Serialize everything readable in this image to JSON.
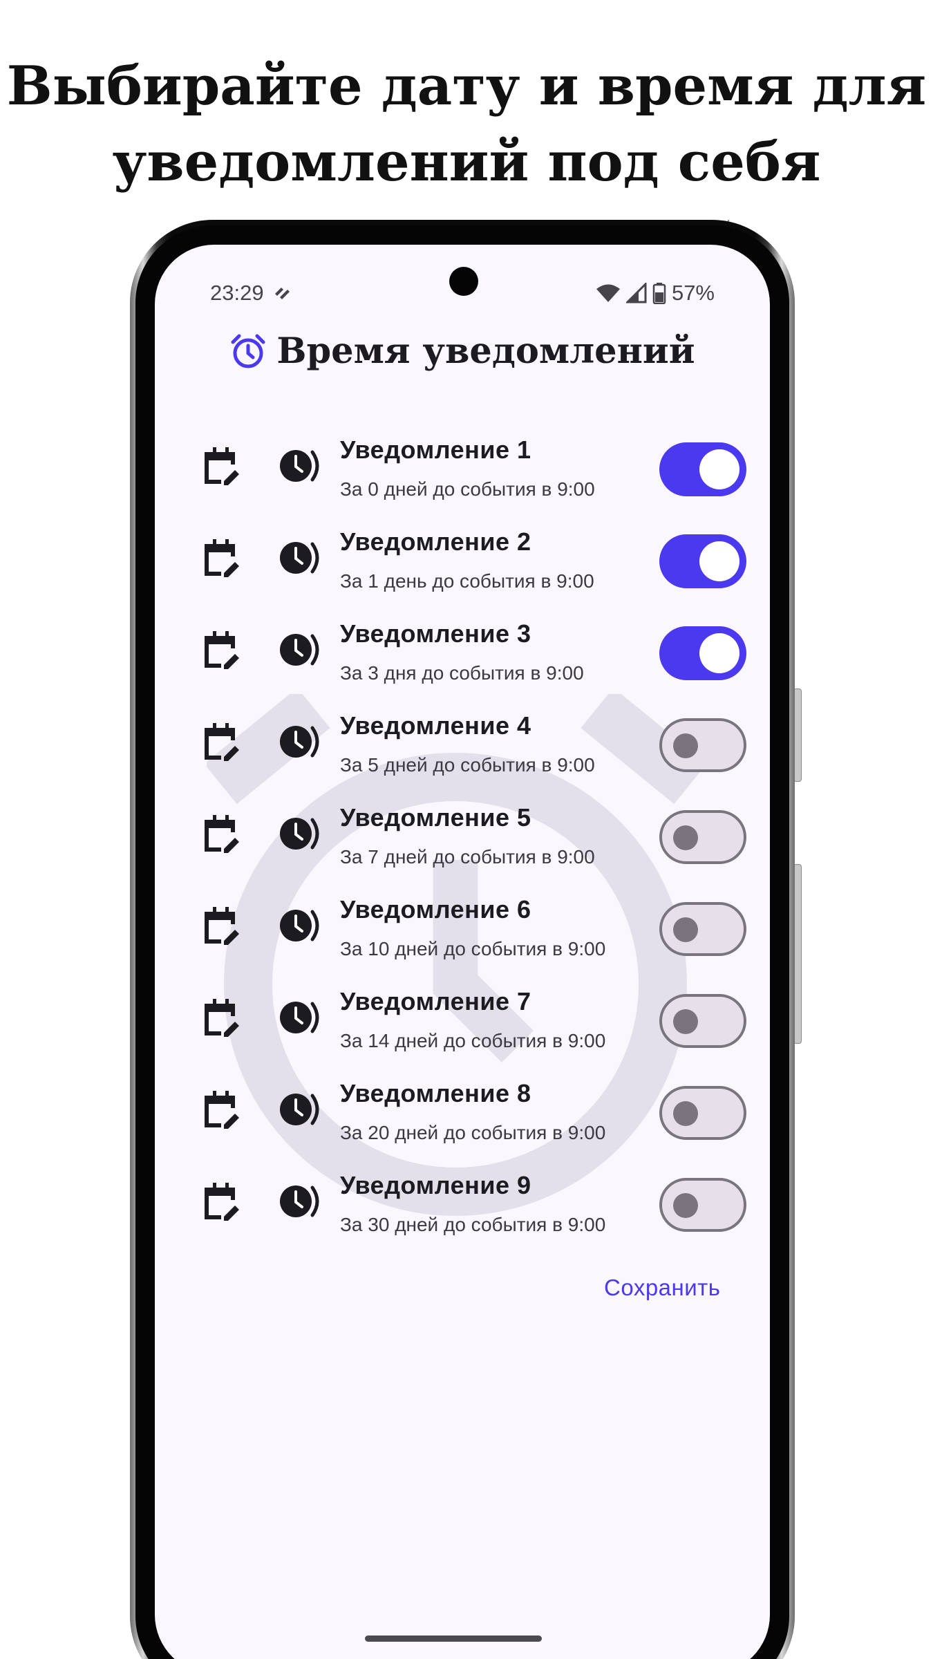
{
  "promo": {
    "line1": "Выбирайте дату и время для",
    "line2": "уведомлений под себя"
  },
  "status_bar": {
    "time": "23:29",
    "battery": "57%"
  },
  "dialog": {
    "title": "Время уведомлений",
    "title_icon": "alarm-clock-icon",
    "accent_color": "#4b39ef"
  },
  "notifications": [
    {
      "name": "Уведомление 1",
      "desc": "За 0 дней до события в 9:00",
      "enabled": true
    },
    {
      "name": "Уведомление 2",
      "desc": "За 1 день до события в 9:00",
      "enabled": true
    },
    {
      "name": "Уведомление 3",
      "desc": "За 3 дня до события в 9:00",
      "enabled": true
    },
    {
      "name": "Уведомление 4",
      "desc": "За 5 дней до события в 9:00",
      "enabled": false
    },
    {
      "name": "Уведомление 5",
      "desc": "За 7 дней до события в 9:00",
      "enabled": false
    },
    {
      "name": "Уведомление 6",
      "desc": "За 10 дней до события в 9:00",
      "enabled": false
    },
    {
      "name": "Уведомление 7",
      "desc": "За 14 дней до события в 9:00",
      "enabled": false
    },
    {
      "name": "Уведомление 8",
      "desc": "За 20 дней до события в 9:00",
      "enabled": false
    },
    {
      "name": "Уведомление 9",
      "desc": "За 30 дней до события в 9:00",
      "enabled": false
    }
  ],
  "row_icons": [
    "calendar-edit-icon",
    "clock-snooze-icon"
  ],
  "actions": {
    "save_label": "Сохранить"
  }
}
